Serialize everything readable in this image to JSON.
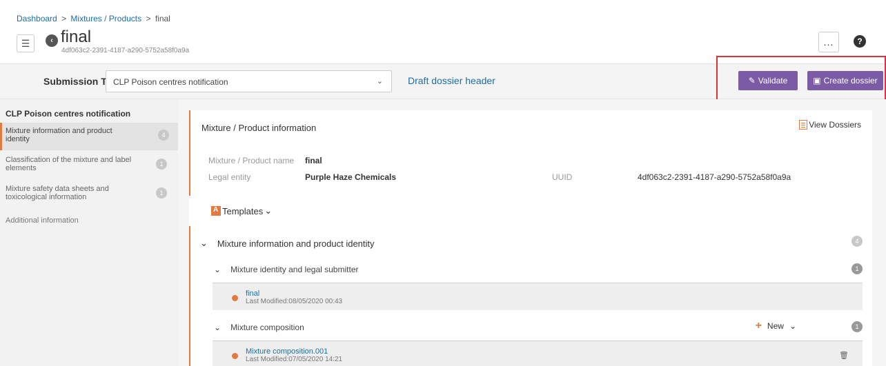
{
  "breadcrumb": {
    "dashboard": "Dashboard",
    "sep1": ">",
    "mixtures": "Mixtures / Products",
    "sep2": ">",
    "current": "final"
  },
  "header": {
    "title": "final",
    "uuid": "4df063c2-2391-4187-a290-5752a58f0a9a",
    "more_label": "...",
    "help_label": "?"
  },
  "submission": {
    "label": "Submission Type:",
    "selected": "CLP Poison centres notification",
    "draft_link": "Draft dossier header",
    "validate_label": "Validate",
    "create_label": "Create dossier"
  },
  "sidebar": {
    "title": "CLP Poison centres notification",
    "items": [
      {
        "label": "Mixture information and product identity",
        "count": "4"
      },
      {
        "label": "Classification of the mixture and label elements",
        "count": "1"
      },
      {
        "label": "Mixture safety data sheets and toxicological information",
        "count": "1"
      }
    ],
    "additional": "Additional information"
  },
  "info_card": {
    "title": "Mixture / Product information",
    "view_dossiers": "View Dossiers",
    "name_label": "Mixture / Product name",
    "name_value": "final",
    "entity_label": "Legal entity",
    "entity_value": "Purple Haze Chemicals",
    "uuid_label": "UUID",
    "uuid_value": "4df063c2-2391-4187-a290-5752a58f0a9a"
  },
  "templates": {
    "label": "Templates"
  },
  "section": {
    "title": "Mixture information and product identity",
    "count": "4",
    "sub1": {
      "title": "Mixture identity and legal submitter",
      "count": "1"
    },
    "entry1": {
      "name": "final",
      "modified": "Last Modified:08/05/2020 00:43"
    },
    "sub2": {
      "title": "Mixture composition",
      "count": "1",
      "new_label": "New"
    },
    "entry2": {
      "name": "Mixture composition.001",
      "modified": "Last Modified:07/05/2020 14:21"
    }
  },
  "colors": {
    "accent": "#e07a3f",
    "link": "#1a6ea3",
    "purple": "#7b5ba6",
    "highlight": "#d9343c"
  }
}
